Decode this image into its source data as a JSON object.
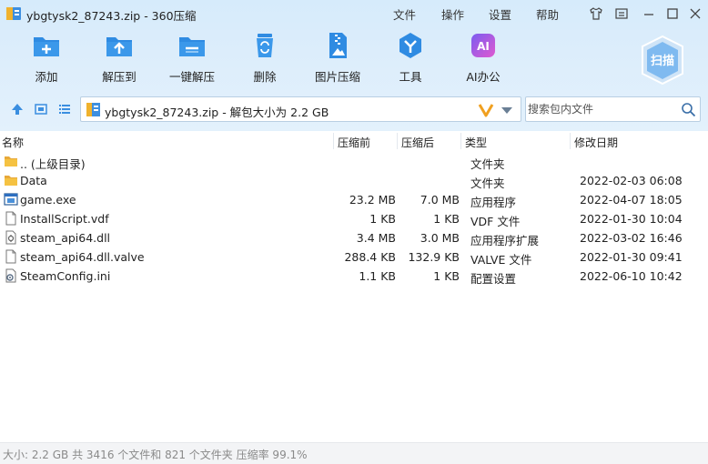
{
  "window": {
    "title": "ybgtysk2_87243.zip - 360压缩"
  },
  "menu": {
    "file": "文件",
    "operate": "操作",
    "settings": "设置",
    "help": "帮助"
  },
  "toolbar": {
    "add": "添加",
    "extract_to": "解压到",
    "one_click_extract": "一键解压",
    "delete": "删除",
    "image_compress": "图片压缩",
    "tools": "工具",
    "ai_office": "AI办公",
    "ai_badge": "AI",
    "scan": "扫描"
  },
  "address": {
    "path": "ybgtysk2_87243.zip - 解包大小为 2.2 GB"
  },
  "search": {
    "placeholder": "搜索包内文件"
  },
  "columns": {
    "name": "名称",
    "packed": "压缩前",
    "size": "压缩后",
    "type": "类型",
    "modified": "修改日期"
  },
  "files": [
    {
      "icon": "folder-up-icon",
      "name": ".. (上级目录)",
      "packed": "",
      "size": "",
      "type": "文件夹",
      "modified": ""
    },
    {
      "icon": "folder-icon",
      "name": "Data",
      "packed": "",
      "size": "",
      "type": "文件夹",
      "modified": "2022-02-03 06:08"
    },
    {
      "icon": "exe-icon",
      "name": "game.exe",
      "packed": "23.2 MB",
      "size": "7.0 MB",
      "type": "应用程序",
      "modified": "2022-04-07 18:05"
    },
    {
      "icon": "file-icon",
      "name": "InstallScript.vdf",
      "packed": "1 KB",
      "size": "1 KB",
      "type": "VDF 文件",
      "modified": "2022-01-30 10:04"
    },
    {
      "icon": "dll-icon",
      "name": "steam_api64.dll",
      "packed": "3.4 MB",
      "size": "3.0 MB",
      "type": "应用程序扩展",
      "modified": "2022-03-02 16:46"
    },
    {
      "icon": "file-icon",
      "name": "steam_api64.dll.valve",
      "packed": "288.4 KB",
      "size": "132.9 KB",
      "type": "VALVE 文件",
      "modified": "2022-01-30 09:41"
    },
    {
      "icon": "ini-icon",
      "name": "SteamConfig.ini",
      "packed": "1.1 KB",
      "size": "1 KB",
      "type": "配置设置",
      "modified": "2022-06-10 10:42"
    }
  ],
  "status": {
    "text": "大小: 2.2 GB 共 3416 个文件和 821 个文件夹 压缩率 99.1%"
  },
  "colors": {
    "accent": "#2b8be0",
    "header_bg": "#dcedfb",
    "folder": "#f5c242"
  }
}
